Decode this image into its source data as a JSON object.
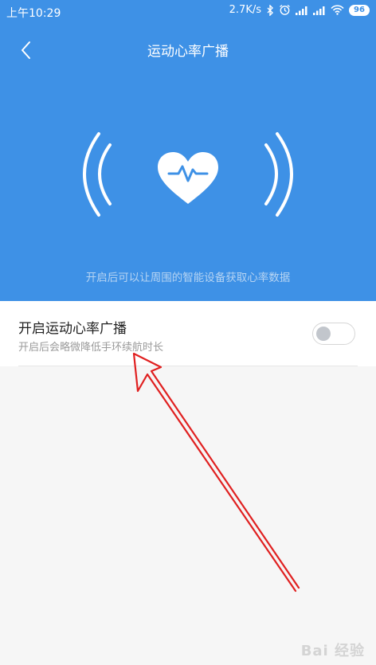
{
  "status_bar": {
    "time": "上午10:29",
    "net_speed": "2.7K/s",
    "battery": "96"
  },
  "header": {
    "title": "运动心率广播"
  },
  "hero": {
    "caption": "开启后可以让周围的智能设备获取心率数据"
  },
  "setting": {
    "title": "开启运动心率广播",
    "description": "开启后会略微降低手环续航时长",
    "enabled": false
  },
  "watermark": "Bai 经验",
  "colors": {
    "primary": "#3e91e6",
    "annotation": "#e02020"
  }
}
